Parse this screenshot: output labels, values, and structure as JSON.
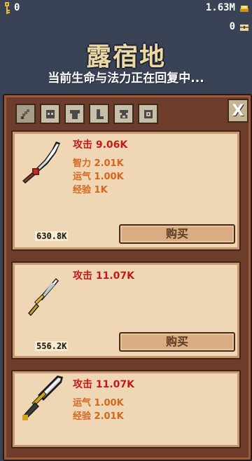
{
  "header": {
    "key_count": "0",
    "gold_amount": "1.63M",
    "gem_count": "0"
  },
  "location": {
    "title": "露宿地",
    "subtitle": "当前生命与法力正在回复中..."
  },
  "shop": {
    "tabs": [
      "sword-icon",
      "helmet-icon",
      "armor-icon",
      "boots-icon",
      "ring-icon",
      "amulet-icon"
    ],
    "close_label": "X",
    "items": [
      {
        "icon": "scimitar-icon",
        "attack": "攻击 9.06K",
        "stats": [
          "智力 2.01K",
          "运气 1.00K",
          "经验 1K"
        ],
        "price": "630.8K",
        "buy_label": "购买"
      },
      {
        "icon": "dagger-icon",
        "attack": "攻击 11.07K",
        "stats": [],
        "price": "556.2K",
        "buy_label": "购买"
      },
      {
        "icon": "broadsword-icon",
        "attack": "攻击 11.07K",
        "stats": [
          "运气 1.00K",
          "经验 2.01K"
        ],
        "price": "",
        "buy_label": ""
      }
    ]
  },
  "colors": {
    "background": "#3a4356",
    "panel": "#6e3c2a",
    "card": "#efd6b4",
    "attack_text": "#c21a1a",
    "stat_text": "#d4661e"
  }
}
